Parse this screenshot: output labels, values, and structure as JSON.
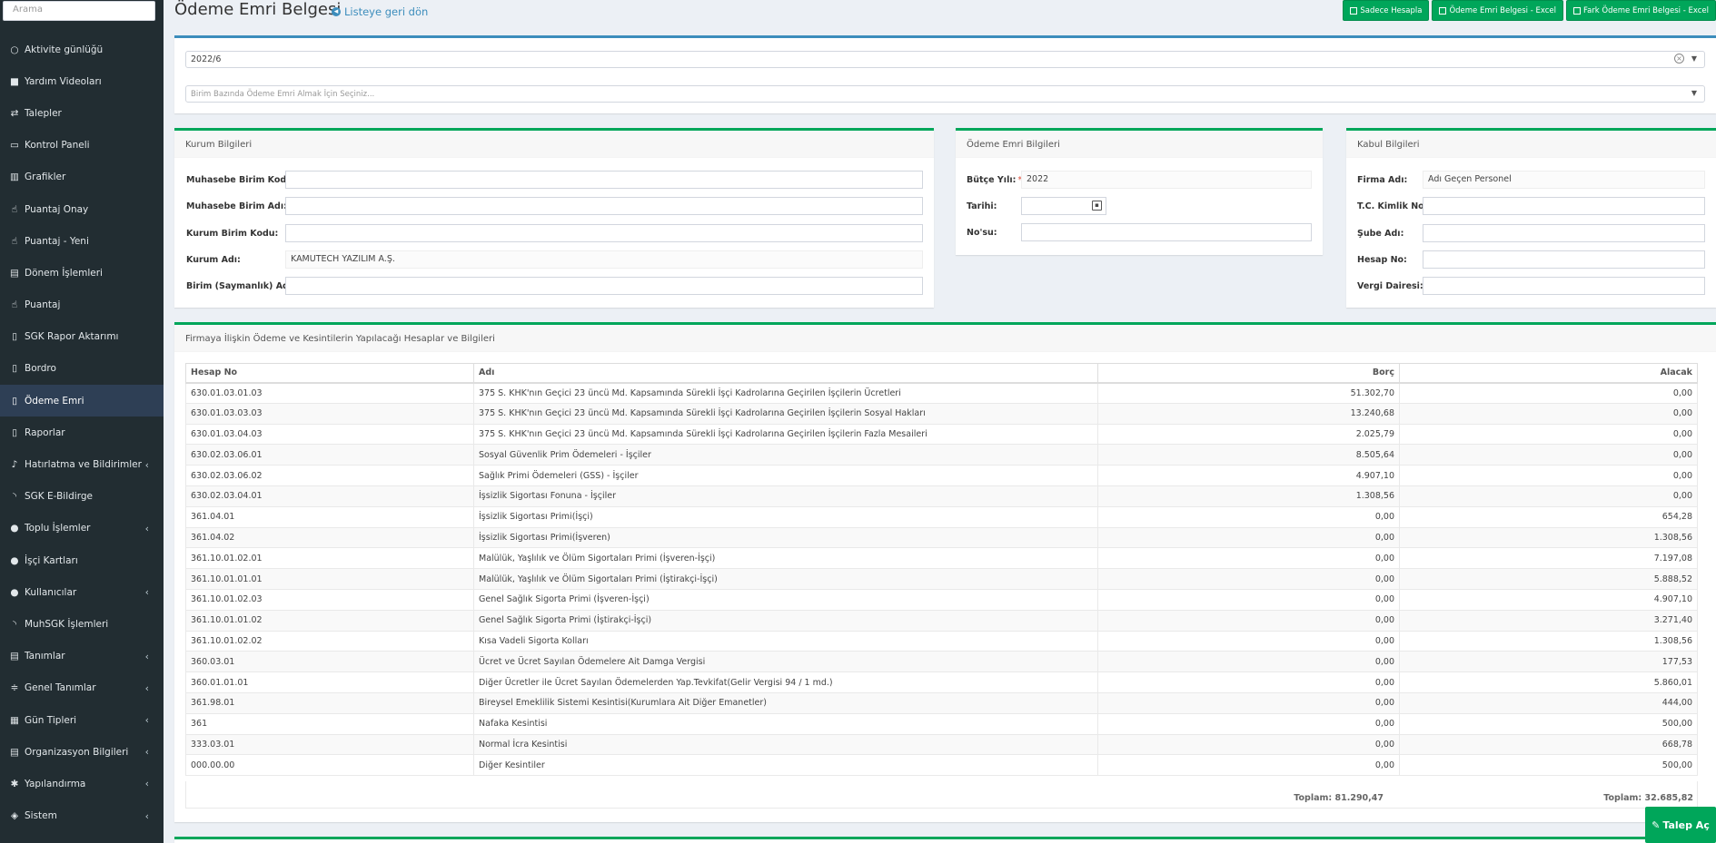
{
  "sidebar": {
    "search_placeholder": "Arama",
    "items": [
      {
        "label": "Aktivite günlüğü",
        "icon": "circle-outline-icon",
        "glyph": "○"
      },
      {
        "label": "Yardım Videoları",
        "icon": "video-camera-icon",
        "glyph": "■"
      },
      {
        "label": "Talepler",
        "icon": "exchange-icon",
        "glyph": "⇄"
      },
      {
        "label": "Kontrol Paneli",
        "icon": "desktop-icon",
        "glyph": "▭"
      },
      {
        "label": "Grafikler",
        "icon": "bar-chart-icon",
        "glyph": "▥"
      },
      {
        "label": "Puantaj Onay",
        "icon": "hand-pointer-icon",
        "glyph": "☝"
      },
      {
        "label": "Puantaj - Yeni",
        "icon": "hand-pointer-icon",
        "glyph": "☝"
      },
      {
        "label": "Dönem İşlemleri",
        "icon": "map-icon",
        "glyph": "▤"
      },
      {
        "label": "Puantaj",
        "icon": "hand-pointer-icon",
        "glyph": "☝"
      },
      {
        "label": "SGK Rapor Aktarımı",
        "icon": "file-icon",
        "glyph": "▯"
      },
      {
        "label": "Bordro",
        "icon": "file-icon",
        "glyph": "▯"
      },
      {
        "label": "Ödeme Emri",
        "icon": "file-icon",
        "glyph": "▯",
        "active": true
      },
      {
        "label": "Raporlar",
        "icon": "file-icon",
        "glyph": "▯"
      },
      {
        "label": "Hatırlatma ve Bildirimler",
        "icon": "bell-icon",
        "glyph": "♪",
        "chevron": true
      },
      {
        "label": "SGK E-Bildirge",
        "icon": "rss-icon",
        "glyph": "◝"
      },
      {
        "label": "Toplu İşlemler",
        "icon": "user-icon",
        "glyph": "●",
        "chevron": true
      },
      {
        "label": "İşçi Kartları",
        "icon": "users-icon",
        "glyph": "●"
      },
      {
        "label": "Kullanıcılar",
        "icon": "user-icon",
        "glyph": "●",
        "chevron": true
      },
      {
        "label": "MuhSGK İşlemleri",
        "icon": "rss-icon",
        "glyph": "◝"
      },
      {
        "label": "Tanımlar",
        "icon": "map-icon",
        "glyph": "▤",
        "chevron": true
      },
      {
        "label": "Genel Tanımlar",
        "icon": "sliders-icon",
        "glyph": "≑",
        "chevron": true
      },
      {
        "label": "Gün Tipleri",
        "icon": "calendar-icon",
        "glyph": "▦",
        "chevron": true
      },
      {
        "label": "Organizasyon Bilgileri",
        "icon": "map-icon",
        "glyph": "▤",
        "chevron": true
      },
      {
        "label": "Yapılandırma",
        "icon": "cog-icon",
        "glyph": "✱",
        "chevron": true
      },
      {
        "label": "Sistem",
        "icon": "cube-icon",
        "glyph": "◈",
        "chevron": true
      }
    ]
  },
  "header": {
    "title": "Ödeme Emri Belgesi",
    "back_link": "Listeye geri dön",
    "buttons": [
      "Sadece Hesapla",
      "Ödeme Emri Belgesi - Excel",
      "Fark Ödeme Emri Belgesi - Excel"
    ]
  },
  "filters": {
    "period_value": "2022/6",
    "unit_placeholder": "Birim Bazında Ödeme Emri Almak İçin Seçiniz..."
  },
  "kurum": {
    "title": "Kurum Bilgileri",
    "fields": [
      {
        "label": "Muhasebe Birim Kodu:",
        "value": ""
      },
      {
        "label": "Muhasebe Birim Adı:",
        "value": ""
      },
      {
        "label": "Kurum Birim Kodu:",
        "value": ""
      },
      {
        "label": "Kurum Adı:",
        "value": "KAMUTECH YAZILIM A.Ş."
      },
      {
        "label": "Birim (Saymanlık) Adı:",
        "value": ""
      }
    ]
  },
  "odeme": {
    "title": "Ödeme Emri Bilgileri",
    "butce_label": "Bütçe Yılı:",
    "butce_req": "*",
    "butce_value": "2022",
    "tarih_label": "Tarihi:",
    "no_label": "No'su:"
  },
  "kabul": {
    "title": "Kabul Bilgileri",
    "fields": [
      {
        "label": "Firma Adı:",
        "value": "Adı Geçen Personel"
      },
      {
        "label": "T.C. Kimlik No:",
        "value": ""
      },
      {
        "label": "Şube Adı:",
        "value": ""
      },
      {
        "label": "Hesap No:",
        "value": ""
      },
      {
        "label": "Vergi Dairesi:",
        "value": ""
      }
    ]
  },
  "accounts": {
    "title": "Firmaya İlişkin Ödeme ve Kesintilerin Yapılacağı Hesaplar ve Bilgileri",
    "columns": [
      "Hesap No",
      "Adı",
      "Borç",
      "Alacak"
    ],
    "rows": [
      [
        "630.01.03.01.03",
        "375 S. KHK'nın Geçici 23 üncü Md. Kapsamında Sürekli İşçi Kadrolarına Geçirilen İşçilerin Ücretleri",
        "51.302,70",
        "0,00"
      ],
      [
        "630.01.03.03.03",
        "375 S. KHK'nın Geçici 23 üncü Md. Kapsamında Sürekli İşçi Kadrolarına Geçirilen İşçilerin Sosyal Hakları",
        "13.240,68",
        "0,00"
      ],
      [
        "630.01.03.04.03",
        "375 S. KHK'nın Geçici 23 üncü Md. Kapsamında Sürekli İşçi Kadrolarına Geçirilen İşçilerin Fazla Mesaileri",
        "2.025,79",
        "0,00"
      ],
      [
        "630.02.03.06.01",
        "Sosyal Güvenlik Prim Ödemeleri - İşçiler",
        "8.505,64",
        "0,00"
      ],
      [
        "630.02.03.06.02",
        "Sağlık Primi Ödemeleri (GSS) - İşçiler",
        "4.907,10",
        "0,00"
      ],
      [
        "630.02.03.04.01",
        "İşsizlik Sigortası Fonuna - İşçiler",
        "1.308,56",
        "0,00"
      ],
      [
        "361.04.01",
        "İşsizlik Sigortası Primi(İşçi)",
        "0,00",
        "654,28"
      ],
      [
        "361.04.02",
        "İşsizlik Sigortası Primi(İşveren)",
        "0,00",
        "1.308,56"
      ],
      [
        "361.10.01.02.01",
        "Malülük, Yaşlılık ve Ölüm Sigortaları Primi (İşveren-İşçi)",
        "0,00",
        "7.197,08"
      ],
      [
        "361.10.01.01.01",
        "Malülük, Yaşlılık ve Ölüm Sigortaları Primi (İştirakçi-İşçi)",
        "0,00",
        "5.888,52"
      ],
      [
        "361.10.01.02.03",
        "Genel Sağlık Sigorta Primi (İşveren-İşçi)",
        "0,00",
        "4.907,10"
      ],
      [
        "361.10.01.01.02",
        "Genel Sağlık Sigorta Primi (İştirakçi-İşçi)",
        "0,00",
        "3.271,40"
      ],
      [
        "361.10.01.02.02",
        "Kısa Vadeli Sigorta Kolları",
        "0,00",
        "1.308,56"
      ],
      [
        "360.03.01",
        "Ücret ve Ücret Sayılan Ödemelere Ait Damga Vergisi",
        "0,00",
        "177,53"
      ],
      [
        "360.01.01.01",
        "Diğer Ücretler ile Ücret Sayılan Ödemelerden Yap.Tevkifat(Gelir Vergisi 94 / 1 md.)",
        "0,00",
        "5.860,01"
      ],
      [
        "361.98.01",
        "Bireysel Emeklilik Sistemi Kesintisi(Kurumlara Ait Diğer Emanetler)",
        "0,00",
        "444,00"
      ],
      [
        "361",
        "Nafaka Kesintisi",
        "0,00",
        "500,00"
      ],
      [
        "333.03.01",
        "Normal İcra Kesintisi",
        "0,00",
        "668,78"
      ],
      [
        "000.00.00",
        "Diğer Kesintiler",
        "0,00",
        "500,00"
      ]
    ],
    "total_borc": "Toplam: 81.290,47",
    "total_alacak": "Toplam: 32.685,82"
  },
  "talep_button": "Talep Aç",
  "colors": {
    "sidebar": "#222d32",
    "active": "#2e3f55",
    "accent_green": "#00a65a",
    "accent_blue": "#3c8dbc"
  }
}
